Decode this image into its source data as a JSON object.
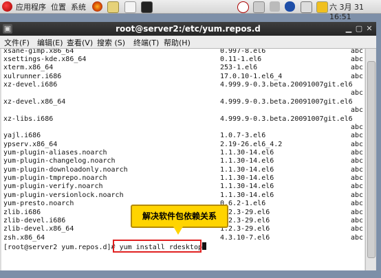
{
  "panel": {
    "apps": "应用程序",
    "places": "位置",
    "system": "系统",
    "datetime": "六 3月 31 16:51"
  },
  "window": {
    "title": "root@server2:/etc/yum.repos.d",
    "menus": [
      "文件(F)",
      "编辑(E)",
      "查看(V)",
      "搜索 (S)",
      "终端(T)",
      "帮助(H)"
    ]
  },
  "terminal": {
    "packages": [
      {
        "name": "xsane-gimp.x86_64",
        "version": "0.997-8.el6",
        "repo": "abc"
      },
      {
        "name": "xsettings-kde.x86_64",
        "version": "0.11-1.el6",
        "repo": "abc"
      },
      {
        "name": "xterm.x86_64",
        "version": "253-1.el6",
        "repo": "abc"
      },
      {
        "name": "xulrunner.i686",
        "version": "17.0.10-1.el6_4",
        "repo": "abc"
      },
      {
        "name": "xz-devel.i686",
        "version": "4.999.9-0.3.beta.20091007git.el6",
        "repo": "abc"
      },
      {
        "name": "xz-devel.x86_64",
        "version": "4.999.9-0.3.beta.20091007git.el6",
        "repo": "abc"
      },
      {
        "name": "xz-libs.i686",
        "version": "4.999.9-0.3.beta.20091007git.el6",
        "repo": "abc"
      },
      {
        "name": "yajl.i686",
        "version": "1.0.7-3.el6",
        "repo": "abc"
      },
      {
        "name": "ypserv.x86_64",
        "version": "2.19-26.el6_4.2",
        "repo": "abc"
      },
      {
        "name": "yum-plugin-aliases.noarch",
        "version": "1.1.30-14.el6",
        "repo": "abc"
      },
      {
        "name": "yum-plugin-changelog.noarch",
        "version": "1.1.30-14.el6",
        "repo": "abc"
      },
      {
        "name": "yum-plugin-downloadonly.noarch",
        "version": "1.1.30-14.el6",
        "repo": "abc"
      },
      {
        "name": "yum-plugin-tmprepo.noarch",
        "version": "1.1.30-14.el6",
        "repo": "abc"
      },
      {
        "name": "yum-plugin-verify.noarch",
        "version": "1.1.30-14.el6",
        "repo": "abc"
      },
      {
        "name": "yum-plugin-versionlock.noarch",
        "version": "1.1.30-14.el6",
        "repo": "abc"
      },
      {
        "name": "yum-presto.noarch",
        "version": "0.6.2-1.el6",
        "repo": "abc"
      },
      {
        "name": "zlib.i686",
        "version": "1.2.3-29.el6",
        "repo": "abc"
      },
      {
        "name": "zlib-devel.i686",
        "version": "1.2.3-29.el6",
        "repo": "abc"
      },
      {
        "name": "zlib-devel.x86_64",
        "version": "1.2.3-29.el6",
        "repo": "abc"
      },
      {
        "name": "zsh.x86_64",
        "version": "4.3.10-7.el6",
        "repo": "abc"
      }
    ],
    "prompt": "[root@server2 yum.repos.d]# ",
    "command": "yum install rdesktop"
  },
  "callout": {
    "text": "解决软件包依赖关系"
  }
}
